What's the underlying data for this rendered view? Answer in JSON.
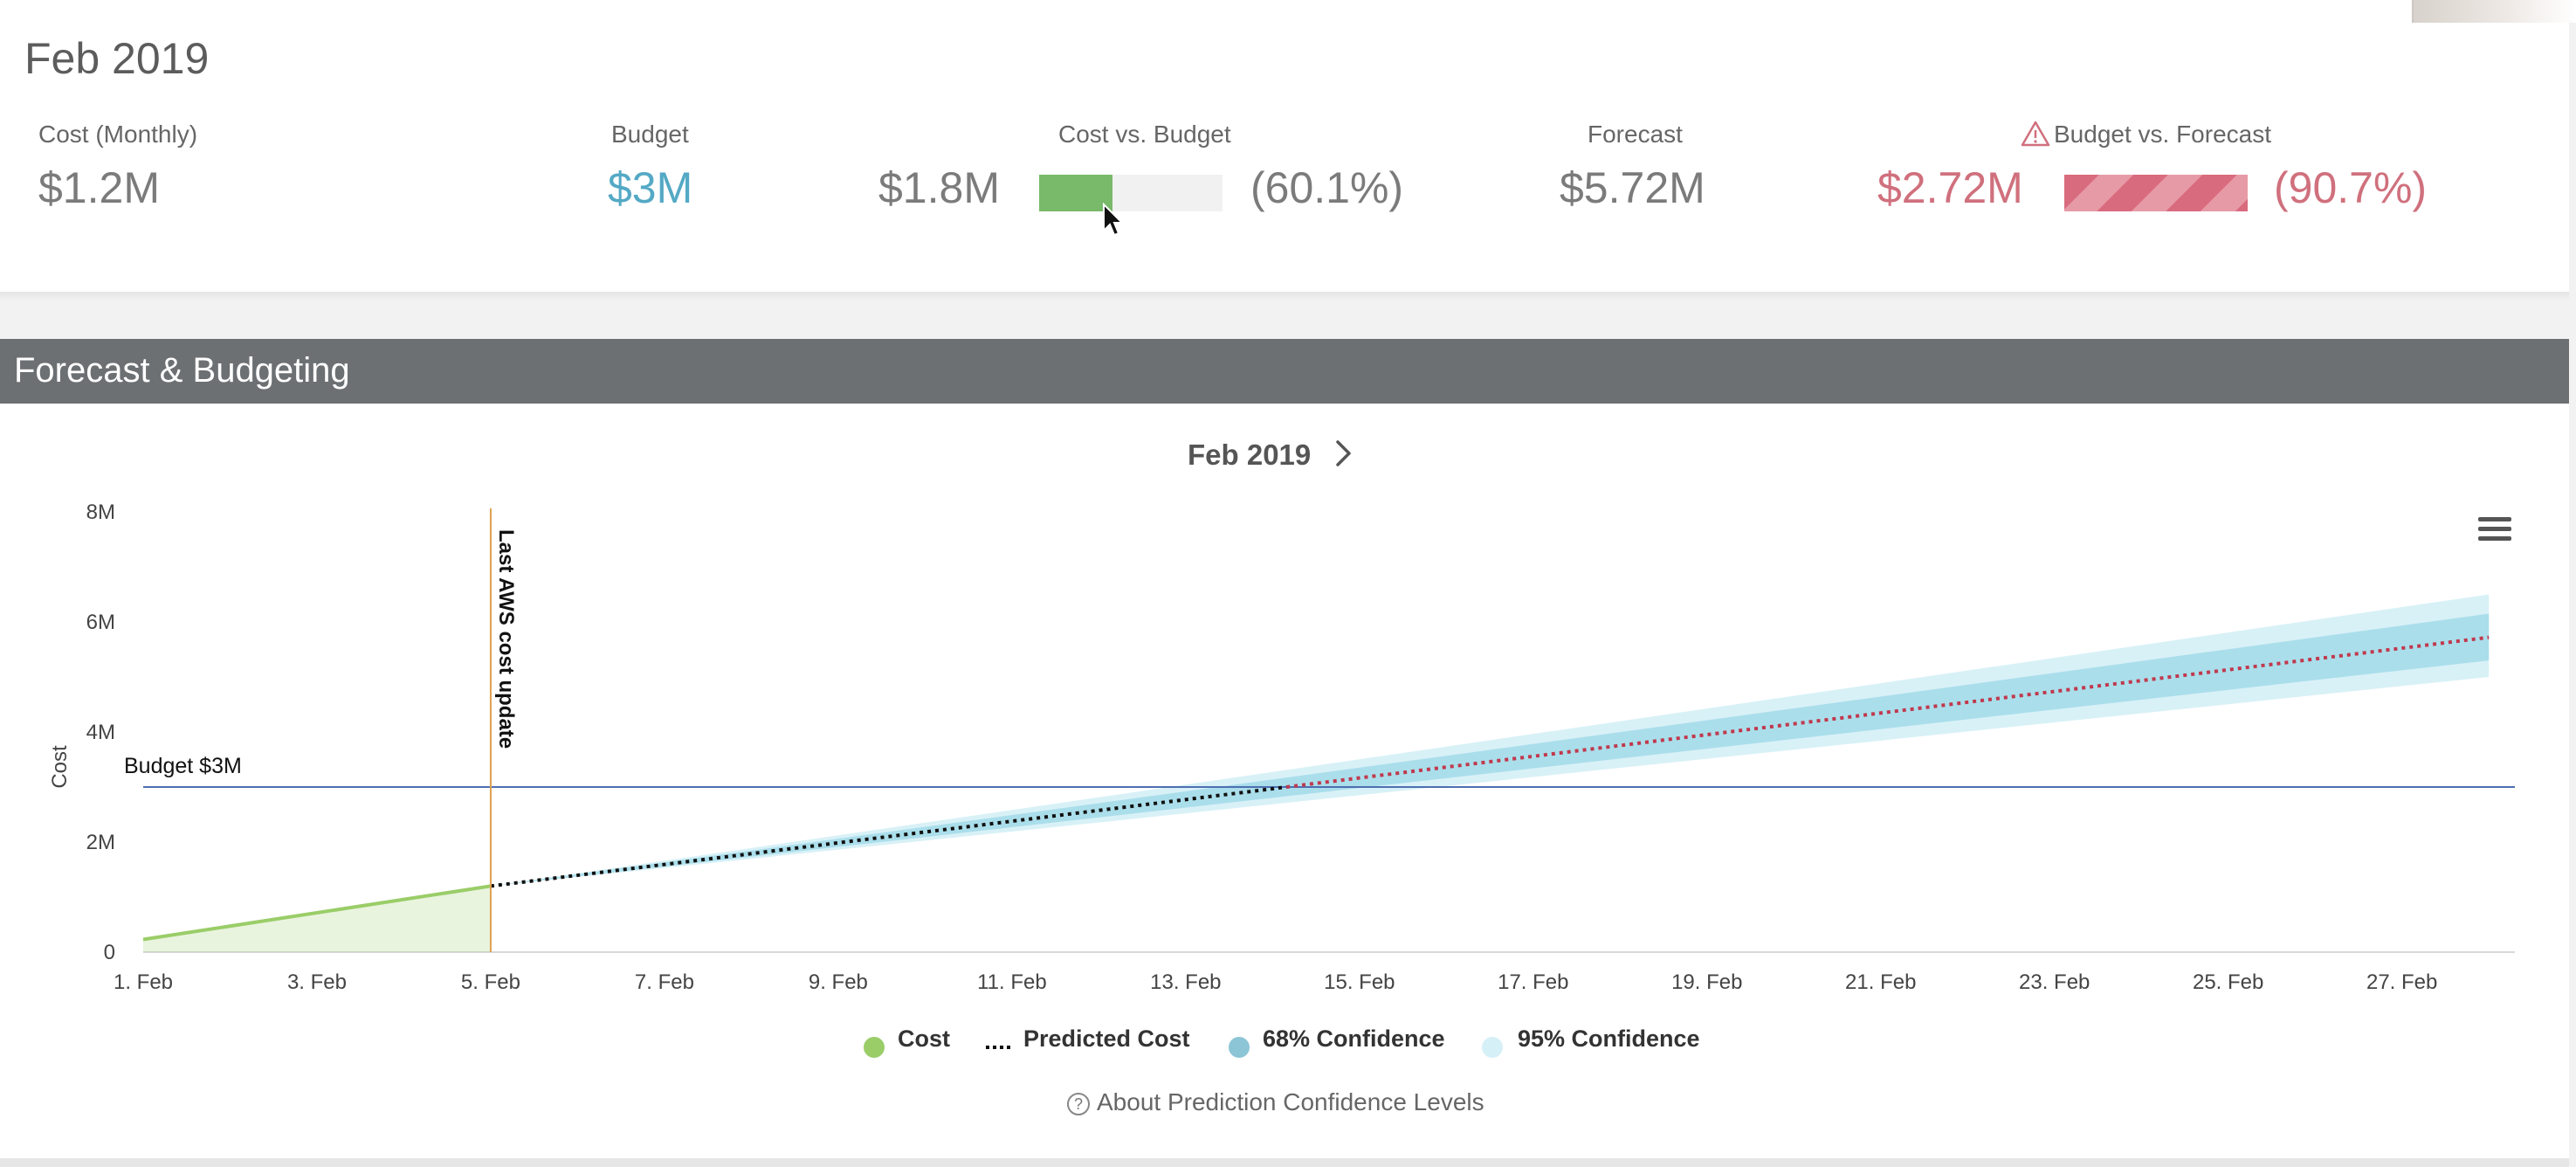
{
  "summary": {
    "period": "Feb 2019",
    "cost_monthly": {
      "label": "Cost (Monthly)",
      "value": "$1.2M"
    },
    "budget": {
      "label": "Budget",
      "value": "$3M"
    },
    "cost_vs_budget": {
      "label": "Cost vs. Budget",
      "value": "$1.8M",
      "percent_text": "(60.1%)",
      "fill_fraction": 0.4
    },
    "forecast": {
      "label": "Forecast",
      "value": "$5.72M"
    },
    "budget_vs_forecast": {
      "label": "Budget vs. Forecast",
      "value": "$2.72M",
      "percent_text": "(90.7%)",
      "fill_fraction": 1.0,
      "icon": "warning-icon"
    }
  },
  "panel": {
    "title": "Forecast & Budgeting",
    "period": "Feb 2019",
    "next_icon": "chevron-right-icon",
    "menu_icon": "hamburger-menu-icon",
    "about_link": "About Prediction Confidence Levels"
  },
  "colors": {
    "cost": "#9acd68",
    "predicted_before_budget": "#111111",
    "predicted_after_budget": "#c0394d",
    "conf68": "#a8dcea",
    "conf95": "#d6f0f7",
    "budget_line": "#4e6fb2",
    "update_line": "#e0a050",
    "bar_ok": "#79b96a",
    "bar_over": "#d96b7e",
    "accent_budget": "#54a9c5",
    "accent_over": "#d0707d"
  },
  "chart_data": {
    "type": "line",
    "title": "",
    "xlabel": "",
    "ylabel": "Cost",
    "xlim": [
      1,
      28.3
    ],
    "ylim": [
      0,
      8000000
    ],
    "yticks": [
      {
        "v": 0,
        "label": "0"
      },
      {
        "v": 2000000,
        "label": "2M"
      },
      {
        "v": 4000000,
        "label": "4M"
      },
      {
        "v": 6000000,
        "label": "6M"
      },
      {
        "v": 8000000,
        "label": "8M"
      }
    ],
    "xticks": [
      {
        "v": 1,
        "label": "1. Feb"
      },
      {
        "v": 3,
        "label": "3. Feb"
      },
      {
        "v": 5,
        "label": "5. Feb"
      },
      {
        "v": 7,
        "label": "7. Feb"
      },
      {
        "v": 9,
        "label": "9. Feb"
      },
      {
        "v": 11,
        "label": "11. Feb"
      },
      {
        "v": 13,
        "label": "13. Feb"
      },
      {
        "v": 15,
        "label": "15. Feb"
      },
      {
        "v": 17,
        "label": "17. Feb"
      },
      {
        "v": 19,
        "label": "19. Feb"
      },
      {
        "v": 21,
        "label": "21. Feb"
      },
      {
        "v": 23,
        "label": "23. Feb"
      },
      {
        "v": 25,
        "label": "25. Feb"
      },
      {
        "v": 27,
        "label": "27. Feb"
      }
    ],
    "budget": {
      "value": 3000000,
      "label": "Budget $3M"
    },
    "last_update": {
      "x": 5,
      "label": "Last AWS cost update"
    },
    "series": [
      {
        "name": "Cost",
        "x": [
          1,
          5
        ],
        "y": [
          230000,
          1200000
        ]
      },
      {
        "name": "Predicted Cost",
        "x": [
          5,
          28
        ],
        "y": [
          1200000,
          5720000
        ]
      },
      {
        "name": "68% Confidence",
        "x": [
          5,
          28
        ],
        "low": [
          1200000,
          5300000
        ],
        "high": [
          1200000,
          6150000
        ]
      },
      {
        "name": "95% Confidence",
        "x": [
          5,
          28
        ],
        "low": [
          1200000,
          5000000
        ],
        "high": [
          1200000,
          6500000
        ]
      }
    ],
    "legend": [
      "Cost",
      "Predicted Cost",
      "68% Confidence",
      "95% Confidence"
    ],
    "legend_position": "bottom"
  }
}
